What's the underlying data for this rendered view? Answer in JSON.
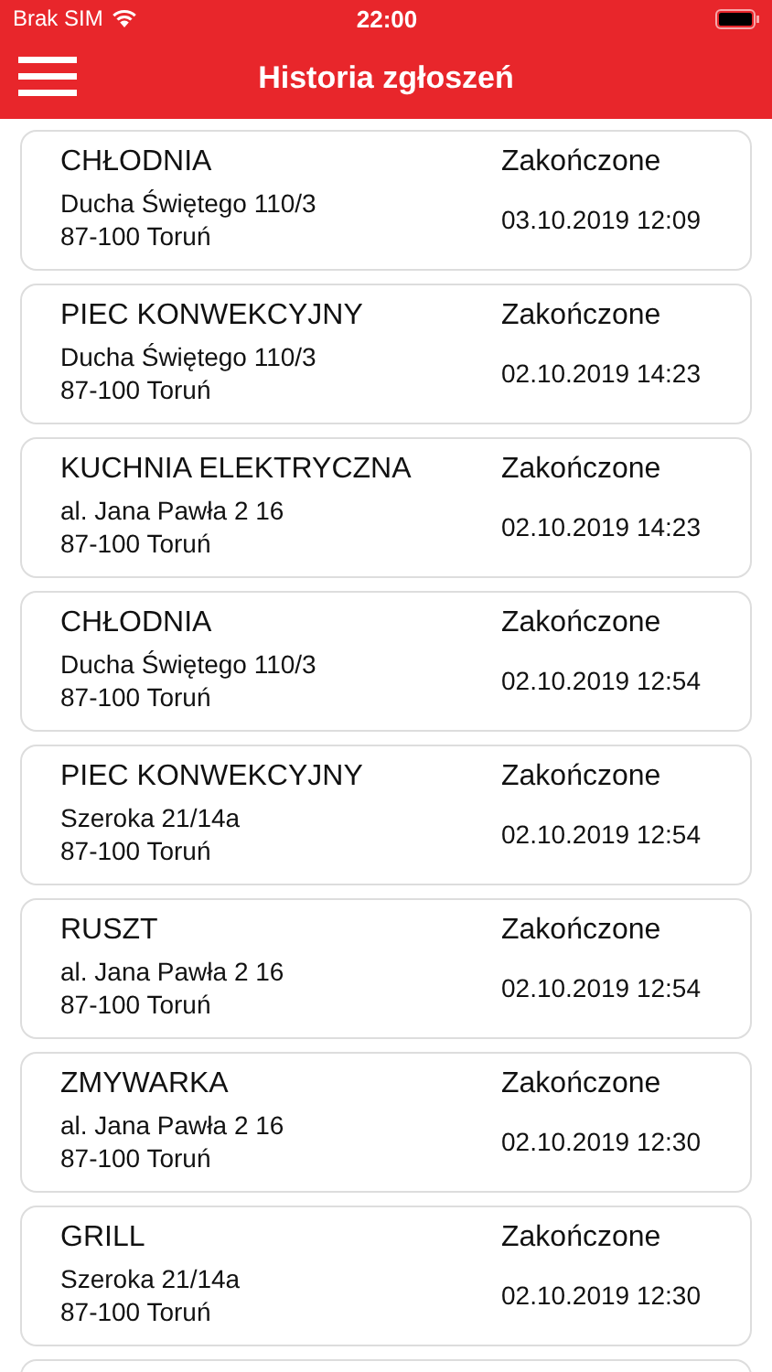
{
  "status_bar": {
    "carrier": "Brak SIM",
    "time": "22:00"
  },
  "nav_bar": {
    "title": "Historia zgłoszeń"
  },
  "requests": [
    {
      "device": "CHŁODNIA",
      "street": "Ducha Świętego 110/3",
      "city": "87-100 Toruń",
      "status": "Zakończone",
      "date": "03.10.2019 12:09"
    },
    {
      "device": "PIEC KONWEKCYJNY",
      "street": "Ducha Świętego 110/3",
      "city": "87-100 Toruń",
      "status": "Zakończone",
      "date": "02.10.2019 14:23"
    },
    {
      "device": "KUCHNIA ELEKTRYCZNA",
      "street": "al. Jana Pawła 2 16",
      "city": "87-100 Toruń",
      "status": "Zakończone",
      "date": "02.10.2019 14:23"
    },
    {
      "device": "CHŁODNIA",
      "street": "Ducha Świętego 110/3",
      "city": "87-100 Toruń",
      "status": "Zakończone",
      "date": "02.10.2019 12:54"
    },
    {
      "device": "PIEC KONWEKCYJNY",
      "street": "Szeroka 21/14a",
      "city": "87-100 Toruń",
      "status": "Zakończone",
      "date": "02.10.2019 12:54"
    },
    {
      "device": "RUSZT",
      "street": "al. Jana Pawła 2 16",
      "city": "87-100 Toruń",
      "status": "Zakończone",
      "date": "02.10.2019 12:54"
    },
    {
      "device": "ZMYWARKA",
      "street": "al. Jana Pawła 2 16",
      "city": "87-100 Toruń",
      "status": "Zakończone",
      "date": "02.10.2019 12:30"
    },
    {
      "device": "GRILL",
      "street": "Szeroka 21/14a",
      "city": "87-100 Toruń",
      "status": "Zakończone",
      "date": "02.10.2019 12:30"
    }
  ]
}
